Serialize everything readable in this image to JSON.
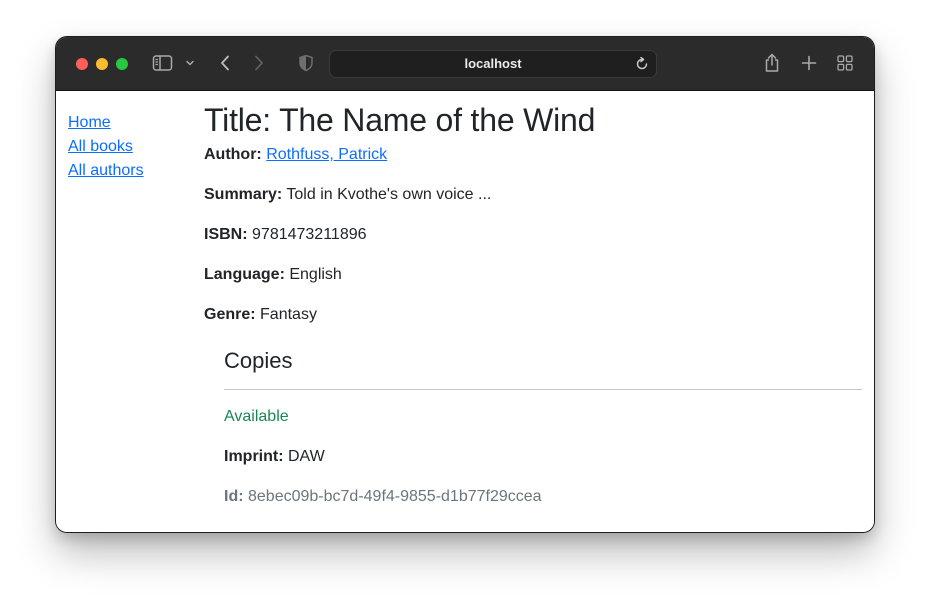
{
  "browser": {
    "address": "localhost"
  },
  "sidebar": {
    "links": [
      {
        "label": "Home"
      },
      {
        "label": "All books"
      },
      {
        "label": "All authors"
      }
    ]
  },
  "book": {
    "title": "Title: The Name of the Wind",
    "author_label": "Author:",
    "author_value": "Rothfuss, Patrick",
    "summary_label": "Summary:",
    "summary_value": "Told in Kvothe's own voice ...",
    "isbn_label": "ISBN:",
    "isbn_value": "9781473211896",
    "language_label": "Language:",
    "language_value": "English",
    "genre_label": "Genre:",
    "genre_value": "Fantasy"
  },
  "copies": {
    "heading": "Copies",
    "items": [
      {
        "status": "Available",
        "imprint_label": "Imprint:",
        "imprint_value": "DAW",
        "id_label": "Id:",
        "id_value": "8ebec09b-bc7d-49f4-9855-d1b77f29ccea"
      }
    ]
  },
  "colors": {
    "link": "#0d6efd",
    "available": "#198754",
    "muted": "#6c757d",
    "toolbar": "#2b2b2c"
  }
}
